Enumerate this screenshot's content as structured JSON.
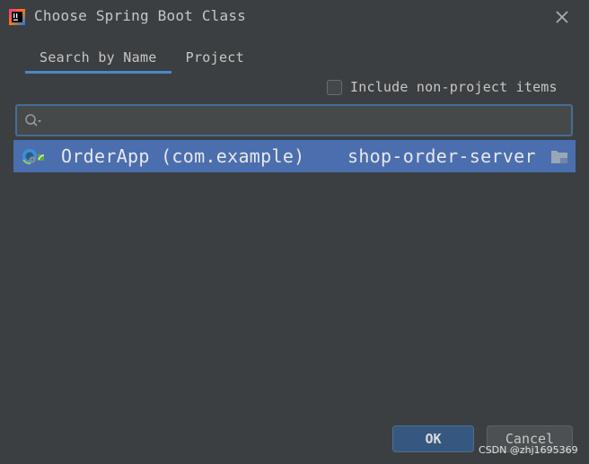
{
  "window": {
    "title": "Choose Spring Boot Class"
  },
  "tabs": [
    {
      "label": "Search by Name",
      "active": true
    },
    {
      "label": "Project",
      "active": false
    }
  ],
  "options": {
    "include_non_project_label": "Include non-project items",
    "include_non_project_checked": false
  },
  "search": {
    "value": "",
    "placeholder": ""
  },
  "results": [
    {
      "name": "OrderApp (com.example)",
      "module": "shop-order-server",
      "icon": "spring-boot-class-icon",
      "module_icon": "module-folder-icon",
      "selected": true
    }
  ],
  "buttons": {
    "ok_label": "OK",
    "cancel_label": "Cancel"
  },
  "watermark": "CSDN @zhj1695369",
  "colors": {
    "background": "#3c3f41",
    "selection": "#4b6eaf",
    "accent": "#4a88c7",
    "ok_button": "#365880"
  }
}
